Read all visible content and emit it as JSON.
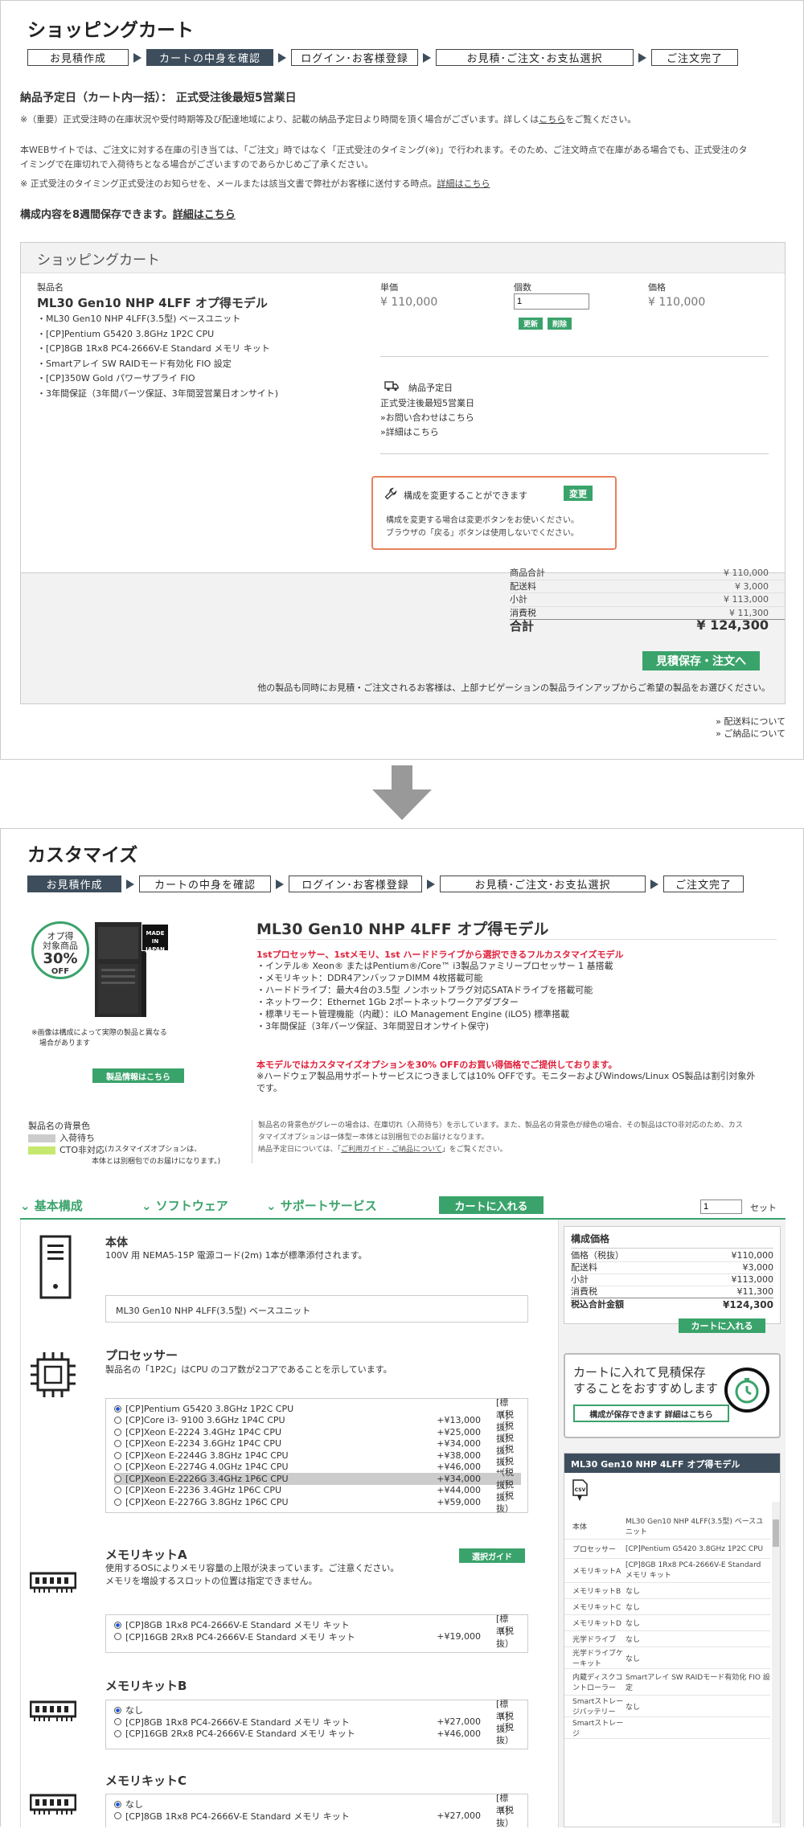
{
  "steps": [
    "お見積作成",
    "カートの中身を確認",
    "ログイン･お客様登録",
    "お見積･ご注文･お支払選択",
    "ご注文完了"
  ],
  "cart": {
    "title": "ショッピングカート",
    "delivery_heading": "納品予定日（カート内一括）： 正式受注後最短5営業日",
    "note1_a": "※（重要）正式受注時の在庫状況や受付時期等及び配達地域により、記載の納品予定日より時間を頂く場合がございます。詳しくは",
    "note1_link": "こちら",
    "note1_b": "をご覧ください。",
    "note2_a": "本WEBサイトでは、ご注文に対する在庫の引き当ては、「ご注文」時ではなく「正式受注のタイミング(※)」で行われます。そのため、ご注文時点で在庫がある場合でも、正式受注のタ",
    "note2_b": "イミングで在庫切れで入荷待ちとなる場合がございますのであらかじめご了承ください。",
    "note3_a": "※ 正式受注のタイミング正式受注のお知らせを、メールまたは該当文書で弊社がお客様に送付する時点。",
    "note3_link": "詳細はこちら",
    "save_text": "構成内容を8週間保存できます。",
    "save_link": "詳細はこちら",
    "box_title": "ショッピングカート",
    "col_product": "製品名",
    "col_unit": "単価",
    "col_qty": "個数",
    "col_price": "価格",
    "product_name": "ML30 Gen10 NHP 4LFF オプ得モデル",
    "components": [
      "ML30 Gen10 NHP 4LFF(3.5型) ベースユニット",
      "[CP]Pentium G5420 3.8GHz 1P2C CPU",
      "[CP]8GB 1Rx8 PC4-2666V-E Standard メモリ キット",
      "Smartアレイ SW RAIDモード有効化 FIO 設定",
      "[CP]350W Gold パワーサプライ FIO",
      "3年間保証（3年間パーツ保証、3年間翌営業日オンサイト)"
    ],
    "unit_price": "¥ 110,000",
    "qty": "1",
    "btn_update": "更新",
    "btn_delete": "削除",
    "price": "¥ 110,000",
    "delivery_label": "納品予定日",
    "delivery_value": "正式受注後最短5営業日",
    "inquiry_link": "»お問い合わせはこちら",
    "detail_link": "»詳細はこちら",
    "change_title": "構成を変更することができます",
    "change_btn": "変更",
    "change_note1": "構成を変更する場合は変更ボタンをお使いください。",
    "change_note2": "ブラウザの「戻る」ボタンは使用しないでください。",
    "totals": [
      {
        "k": "商品合計",
        "v": "¥ 110,000"
      },
      {
        "k": "配送料",
        "v": "¥ 3,000"
      },
      {
        "k": "小計",
        "v": "¥ 113,000"
      },
      {
        "k": "消費税",
        "v": "¥ 11,300"
      }
    ],
    "grand_label": "合計",
    "grand_value": "¥ 124,300",
    "save_order_btn": "見積保存・注文へ",
    "bottom_note": "他の製品も同時にお見積・ご注文されるお客様は、上部ナビゲーションの製品ラインアップからご希望の製品をお選びください。",
    "link_shipping": "» 配送料について",
    "link_delivery": "» ご納品について"
  },
  "custom": {
    "title": "カスタマイズ",
    "badge_l1": "オプ得",
    "badge_l2": "対象商品",
    "badge_pct": "30%",
    "badge_off": "OFF",
    "made_in_japan": "MADE IN JAPAN",
    "img_note1": "※画像は構成によって実際の製品と異なる",
    "img_note2": "場合があります",
    "product_info_btn": "製品情報はこちら",
    "product_title": "ML30 Gen10 NHP 4LFF オプ得モデル",
    "red_line": "1stプロセッサー、1stメモリ、1st ハードドライブから選択できるフルカスタマイズモデル",
    "features": [
      "・インテル® Xeon® またはPentium®/Core™ i3製品ファミリープロセッサー 1 基搭載",
      "・メモリキット：DDR4アンバッファDIMM 4枚搭載可能",
      "・ハードドライブ：最大4台の3.5型 ノンホットプラグ対応SATAドライブを搭載可能",
      "・ネットワーク：Ethernet 1Gb 2ポートネットワークアダプター",
      "・標準リモート管理機能（内蔵）：iLO Management Engine (iLO5) 標準搭載",
      "・3年間保証（3年パーツ保証、3年間翌日オンサイト保守)"
    ],
    "promo": "本モデルではカスタマイズオプションを30% OFFのお買い得価格でご提供しております。",
    "promo_note1": "※ハードウェア製品用サポートサービスにつきましては10% OFFです。モニターおよびWindows/Linux OS製品は割引対象外",
    "promo_note2": "です。",
    "legend_title": "製品名の背景色",
    "legend_wait": "入荷待ち",
    "legend_cto": "CTO非対応",
    "legend_cto_note1": "(カスタマイズオプションは、",
    "legend_cto_note2": "本体とは別梱包でのお届けになります。)",
    "legend_desc1": "製品名の背景色がグレーの場合は、在庫切れ（入荷待ち）を示しています。また、製品名の背景色が緑色の場合、その製品はCTO非対応のため、カス",
    "legend_desc2": "タマイズオプションは一体型ー本体とは別梱包でのお届けとなります。",
    "legend_desc3a": "納品予定日については、「",
    "legend_desc3_link": "ご利用ガイド - ご納品について",
    "legend_desc3b": "」をご覧ください。",
    "tabs": [
      "基本構成",
      "ソフトウェア",
      "サポートサービス"
    ],
    "add_cart_btn": "カートに入れる",
    "qty": "1",
    "qty_unit": "セット",
    "body_title": "本体",
    "body_desc": "100V 用 NEMA5-15P 電源コード(2m) 1本が標準添付されます。",
    "body_value": "ML30 Gen10 NHP 4LFF(3.5型) ベースユニット",
    "cpu_title": "プロセッサー",
    "cpu_desc": "製品名の「1P2C」はCPU のコア数が2コアであることを示しています。",
    "cpu_options": [
      {
        "name": "[CP]Pentium G5420 3.8GHz 1P2C CPU",
        "price": "",
        "tag": "[標準]",
        "sel": true
      },
      {
        "name": "[CP]Core i3- 9100 3.6GHz 1P4C CPU",
        "price": "+¥13,000",
        "tag": "（税抜）",
        "sel": false
      },
      {
        "name": "[CP]Xeon E-2224 3.4GHz 1P4C CPU",
        "price": "+¥25,000",
        "tag": "（税抜）",
        "sel": false
      },
      {
        "name": "[CP]Xeon E-2234 3.6GHz 1P4C CPU",
        "price": "+¥34,000",
        "tag": "（税抜）",
        "sel": false
      },
      {
        "name": "[CP]Xeon E-2244G 3.8GHz 1P4C CPU",
        "price": "+¥38,000",
        "tag": "（税抜）",
        "sel": false
      },
      {
        "name": "[CP]Xeon E-2274G 4.0GHz 1P4C CPU",
        "price": "+¥46,000",
        "tag": "（税抜）",
        "sel": false
      },
      {
        "name": "[CP]Xeon E-2226G 3.4GHz 1P6C CPU",
        "price": "+¥34,000",
        "tag": "（税抜）",
        "sel": false,
        "gray": true
      },
      {
        "name": "[CP]Xeon E-2236 3.4GHz 1P6C CPU",
        "price": "+¥44,000",
        "tag": "（税抜）",
        "sel": false
      },
      {
        "name": "[CP]Xeon E-2276G 3.8GHz 1P6C CPU",
        "price": "+¥59,000",
        "tag": "（税抜）",
        "sel": false
      }
    ],
    "memA_title": "メモリキットA",
    "memA_guide": "選択ガイド",
    "memA_desc1": "使用するOSによりメモリ容量の上限が決まっています。ご注意ください。",
    "memA_desc2": "メモリを増設するスロットの位置は指定できません。",
    "memA_options": [
      {
        "name": "[CP]8GB 1Rx8 PC4-2666V-E Standard メモリ キット",
        "price": "",
        "tag": "[標準]",
        "sel": true
      },
      {
        "name": "[CP]16GB 2Rx8 PC4-2666V-E Standard メモリ キット",
        "price": "+¥19,000",
        "tag": "（税抜）",
        "sel": false
      }
    ],
    "memB_title": "メモリキットB",
    "memB_options": [
      {
        "name": "なし",
        "price": "",
        "tag": "[標準]",
        "sel": true
      },
      {
        "name": "[CP]8GB 1Rx8 PC4-2666V-E Standard メモリ キット",
        "price": "+¥27,000",
        "tag": "（税抜）",
        "sel": false
      },
      {
        "name": "[CP]16GB 2Rx8 PC4-2666V-E Standard メモリ キット",
        "price": "+¥46,000",
        "tag": "（税抜）",
        "sel": false
      }
    ],
    "memC_title": "メモリキットC",
    "memC_options": [
      {
        "name": "なし",
        "price": "",
        "tag": "[標準]",
        "sel": true
      },
      {
        "name": "[CP]8GB 1Rx8 PC4-2666V-E Standard メモリ キット",
        "price": "+¥27,000",
        "tag": "（税抜）",
        "sel": false
      }
    ],
    "side_title": "構成価格",
    "side_rows": [
      {
        "k": "価格（税抜）",
        "v": "¥110,000"
      },
      {
        "k": "配送料",
        "v": "¥3,000"
      },
      {
        "k": "小計",
        "v": "¥113,000"
      },
      {
        "k": "消費税",
        "v": "¥11,300"
      }
    ],
    "side_total_k": "税込合計金額",
    "side_total_v": "¥124,300",
    "side_cart_btn": "カートに入れる",
    "rec_line1": "カートに入れて見積保存",
    "rec_line2": "することをおすすめします",
    "rec_btn": "構成が保存できます 詳細はこちら",
    "spec_title": "ML30 Gen10 NHP 4LFF オプ得モデル",
    "spec_csv": "CSV",
    "spec": [
      {
        "k": "本体",
        "v": "ML30 Gen10 NHP 4LFF(3.5型) ベースユニット"
      },
      {
        "k": "プロセッサー",
        "v": "[CP]Pentium G5420 3.8GHz 1P2C CPU"
      },
      {
        "k": "メモリキットA",
        "v": "[CP]8GB 1Rx8 PC4-2666V-E Standard メモリ キット"
      },
      {
        "k": "メモリキットB",
        "v": "なし"
      },
      {
        "k": "メモリキットC",
        "v": "なし"
      },
      {
        "k": "メモリキットD",
        "v": "なし"
      },
      {
        "k": "光学ドライブ",
        "v": "なし"
      },
      {
        "k": "光学ドライブケーキット",
        "v": "なし"
      },
      {
        "k": "内蔵ディスクコントローラー",
        "v": "Smartアレイ SW RAIDモード有効化 FIO 設定"
      },
      {
        "k": "Smartストレージバッテリー",
        "v": "なし"
      },
      {
        "k": "Smartストレージ",
        "v": ""
      }
    ]
  }
}
